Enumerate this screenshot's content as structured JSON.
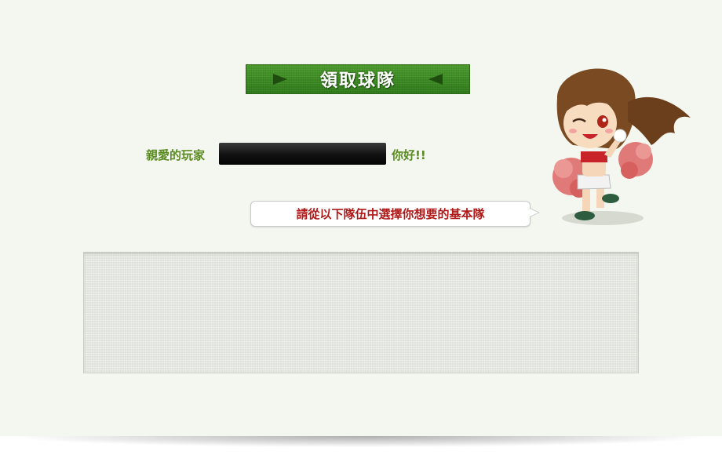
{
  "header": {
    "title": "領取球隊"
  },
  "greeting": {
    "prefix": "親愛的玩家",
    "player_name": "",
    "suffix": "你好!!"
  },
  "instruction": {
    "text": "請從以下隊伍中選擇你想要的基本隊"
  },
  "team_list": {
    "items": []
  },
  "colors": {
    "background": "#f4f7ef",
    "banner_green": "#3f8c25",
    "greeting_green": "#5a8a22",
    "instruction_red": "#b01818",
    "name_box": "#111111",
    "team_box": "#dfe2da"
  },
  "icons": {
    "banner_left": "arrow-right-icon",
    "banner_right": "arrow-left-icon",
    "mascot": "cheerleader-mascot"
  }
}
